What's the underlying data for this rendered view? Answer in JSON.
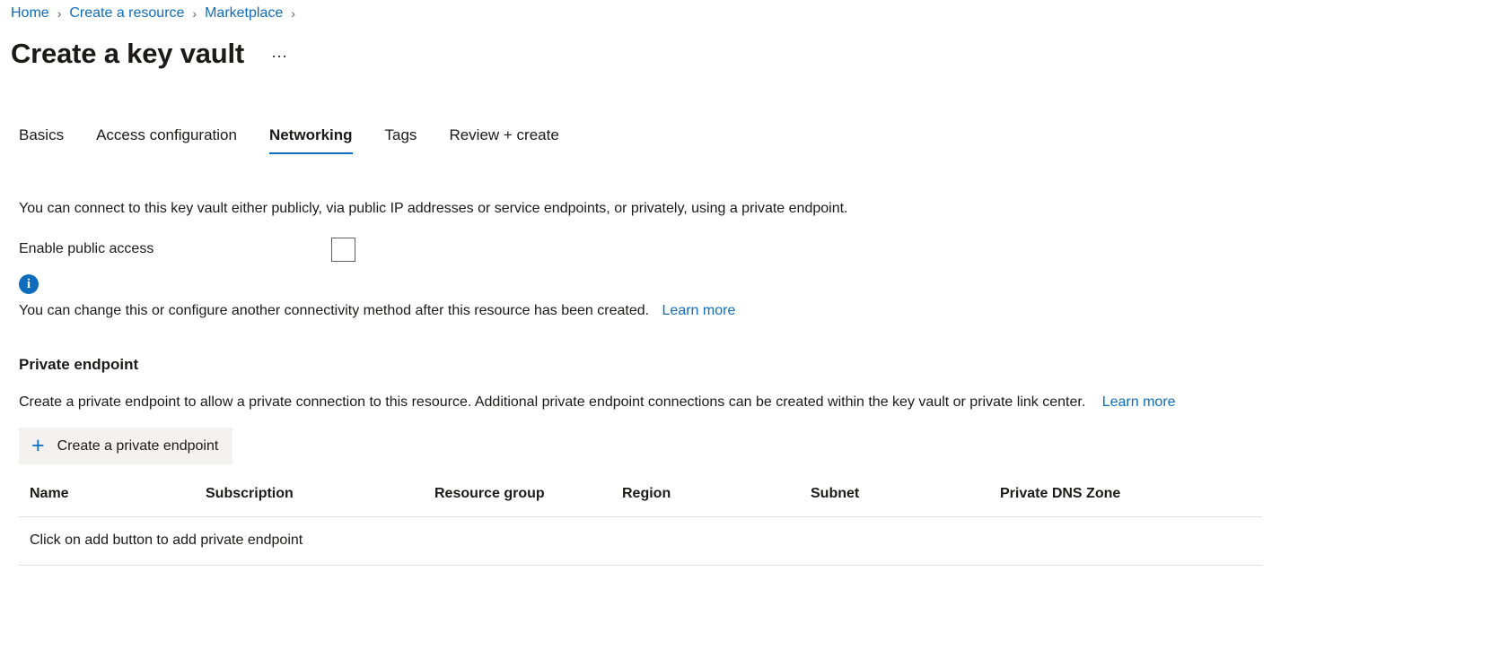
{
  "breadcrumb": {
    "separator": "›",
    "items": [
      {
        "label": "Home"
      },
      {
        "label": "Create a resource"
      },
      {
        "label": "Marketplace"
      }
    ]
  },
  "header": {
    "title": "Create a key vault",
    "more_actions": "⋯"
  },
  "tabs": [
    {
      "label": "Basics",
      "active": false
    },
    {
      "label": "Access configuration",
      "active": false
    },
    {
      "label": "Networking",
      "active": true
    },
    {
      "label": "Tags",
      "active": false
    },
    {
      "label": "Review + create",
      "active": false
    }
  ],
  "main": {
    "intro": "You can connect to this key vault either publicly, via public IP addresses or service endpoints, or privately, using a private endpoint.",
    "public_access": {
      "label": "Enable public access",
      "checked": false
    },
    "info": {
      "icon": "info-icon",
      "glyph": "i",
      "text": "You can change this or configure another connectivity method after this resource has been created.",
      "link_label": "Learn more",
      "color": "#0f6cbd"
    },
    "private_endpoint": {
      "heading": "Private endpoint",
      "description": "Create a private endpoint to allow a private connection to this resource. Additional private endpoint connections can be created within the key vault or private link center.",
      "link_label": "Learn more",
      "add_button": {
        "label": "Create a private endpoint",
        "icon": "plus-icon",
        "glyph": "+"
      },
      "table": {
        "columns": [
          "Name",
          "Subscription",
          "Resource group",
          "Region",
          "Subnet",
          "Private DNS Zone"
        ],
        "empty_message": "Click on add button to add private endpoint",
        "rows": []
      }
    }
  }
}
